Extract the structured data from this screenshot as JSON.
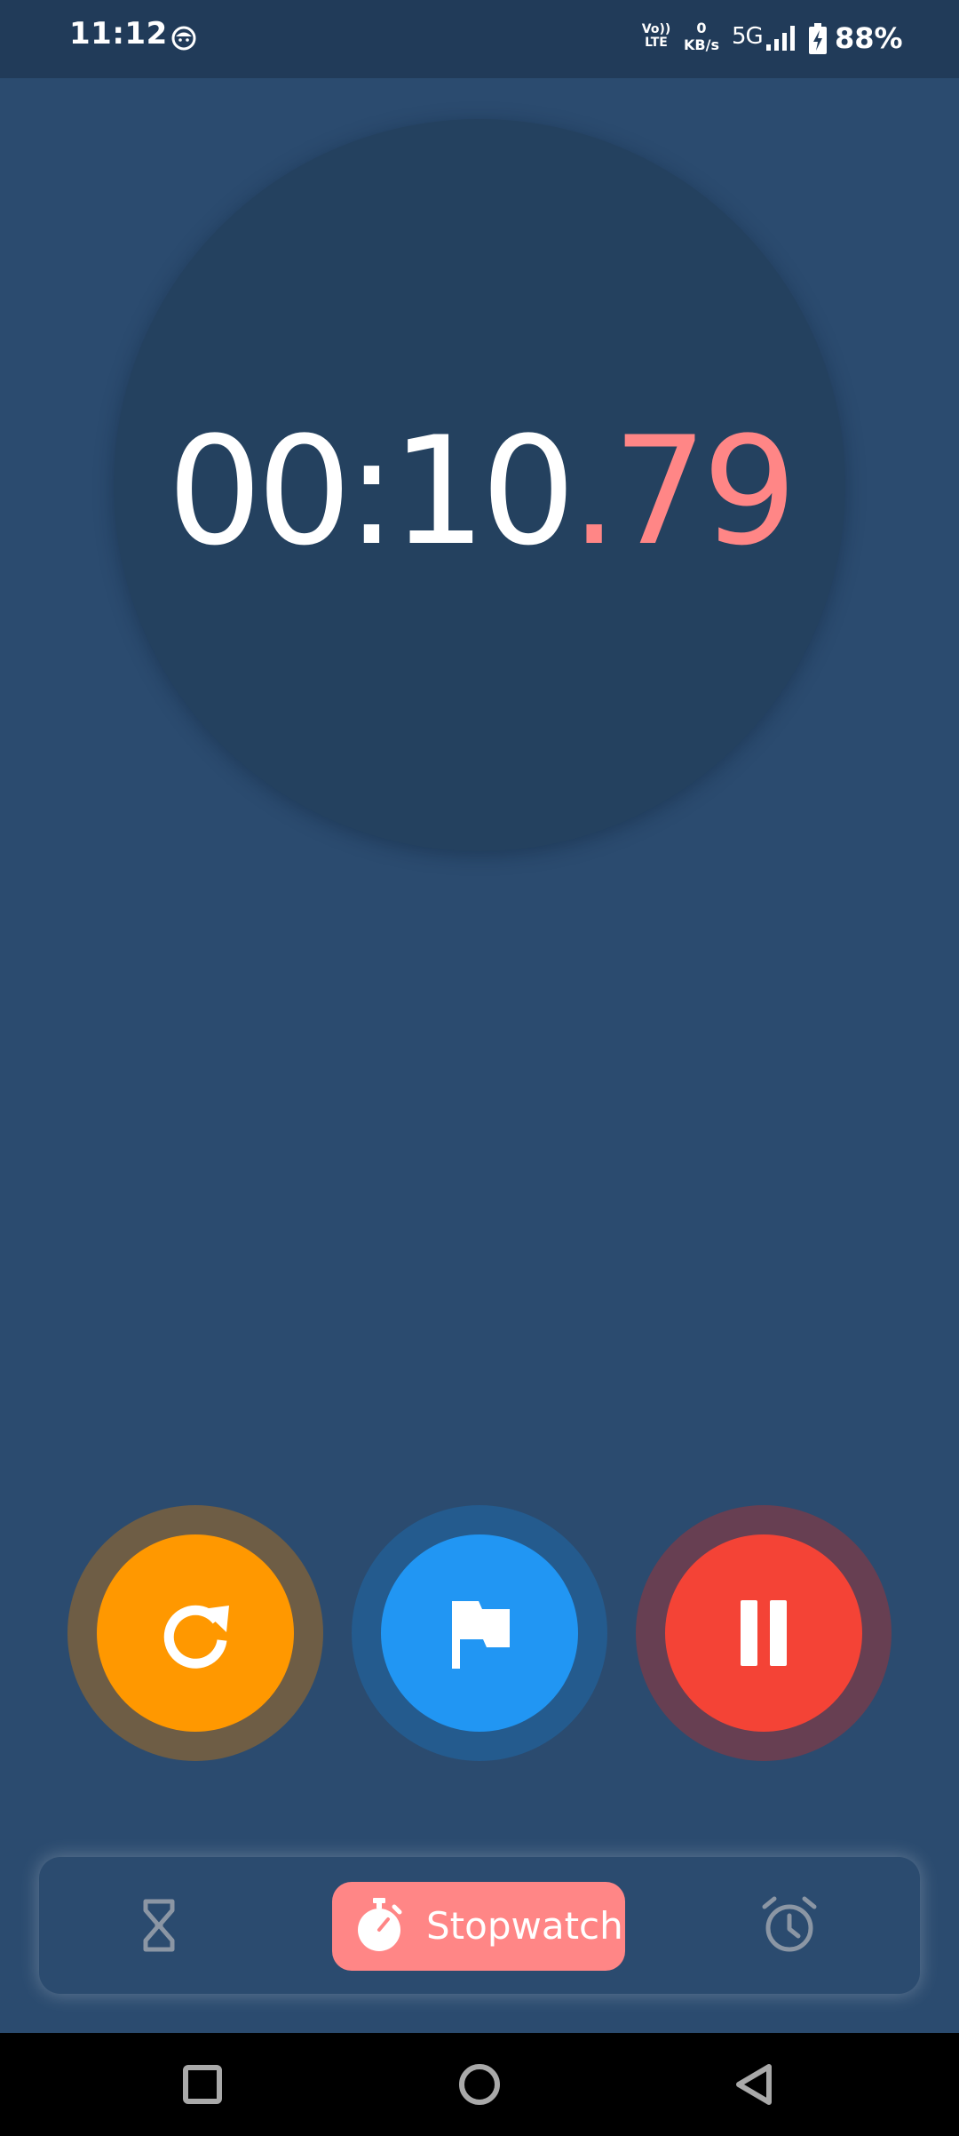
{
  "status_bar": {
    "time": "11:12",
    "app_icon": "notification-app-icon",
    "volte_top": "Vo))",
    "volte_bottom": "LTE",
    "net_speed_value": "0",
    "net_speed_unit": "KB/s",
    "network_type": "5G",
    "signal_icon": "signal-bars-icon",
    "battery_icon": "battery-charging-icon",
    "battery_percent": "88%"
  },
  "timer": {
    "main": "00:10",
    "fraction": ".79",
    "main_color": "#ffffff",
    "fraction_color": "#ff8686"
  },
  "controls": [
    {
      "name": "reset",
      "icon": "reset-icon",
      "color": "#ff9800"
    },
    {
      "name": "lap",
      "icon": "flag-icon",
      "color": "#2196f3"
    },
    {
      "name": "pause",
      "icon": "pause-icon",
      "color": "#f44336"
    }
  ],
  "tabs": {
    "timer_icon": "hourglass-icon",
    "stopwatch_label": "Stopwatch",
    "stopwatch_icon": "stopwatch-icon",
    "alarm_icon": "alarm-clock-icon",
    "active": "Stopwatch",
    "active_color": "#ff8686"
  },
  "nav_bar": {
    "recents_icon": "square-icon",
    "home_icon": "circle-icon",
    "back_icon": "triangle-back-icon"
  },
  "colors": {
    "background": "#2b4b6f",
    "status_bar": "#213b59",
    "dial": "#24415f",
    "nav_bar": "#000000"
  }
}
